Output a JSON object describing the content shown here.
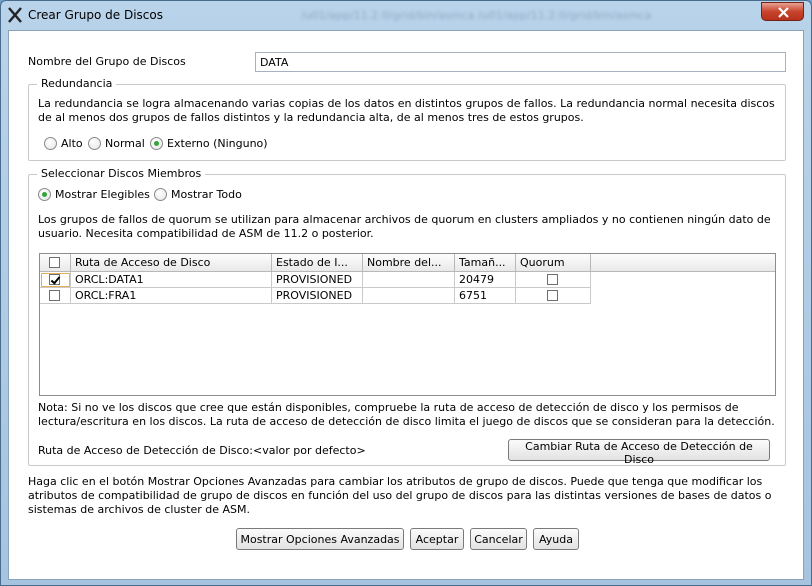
{
  "window": {
    "title": "Crear Grupo de Discos",
    "title_path": "/u01/app/11.2.0/grid/bin/asmca /u01/app/11.2.0/grid/bin/asmca"
  },
  "diskgroup": {
    "name_label": "Nombre del Grupo de Discos",
    "name_value": "DATA"
  },
  "redundancy": {
    "legend": "Redundancia",
    "description": "La redundancia se logra almacenando varias copias de los datos en distintos grupos de fallos. La redundancia normal necesita discos de al menos dos grupos de fallos distintos y la redundancia alta, de al menos tres de estos grupos.",
    "options": [
      "Alto",
      "Normal",
      "Externo (Ninguno)"
    ],
    "selected": "Externo (Ninguno)"
  },
  "members": {
    "legend": "Seleccionar Discos Miembros",
    "show_options": [
      "Mostrar Elegibles",
      "Mostrar Todo"
    ],
    "selected": "Mostrar Elegibles",
    "quorum_note": "Los grupos de fallos de quorum se utilizan para almacenar archivos de quorum en clusters ampliados y no contienen ningún dato de usuario. Necesita compatibilidad de ASM de 11.2 o posterior.",
    "table": {
      "columns": [
        "",
        "Ruta de Acceso de Disco",
        "Estado de I...",
        "Nombre del...",
        "Tamañ...",
        "Quorum"
      ],
      "rows": [
        {
          "selected": true,
          "path": "ORCL:DATA1",
          "status": "PROVISIONED",
          "name": "",
          "size": "20479",
          "quorum": false
        },
        {
          "selected": false,
          "path": "ORCL:FRA1",
          "status": "PROVISIONED",
          "name": "",
          "size": "6751",
          "quorum": false
        }
      ]
    },
    "note": "Nota: Si no ve los discos que cree que están disponibles, compruebe la ruta de acceso de detección de disco y los permisos de lectura/escritura en los discos. La ruta de acceso de detección de disco limita el juego de discos que se consideran para la detección.",
    "discovery_label": "Ruta de Acceso de Detección de Disco:<valor por defecto>",
    "change_discovery_button": "Cambiar Ruta de Acceso de Detección de Disco"
  },
  "advanced_note": "Haga clic en el botón Mostrar Opciones Avanzadas para cambiar los atributos de grupo de discos. Puede que tenga que modificar los atributos de compatibilidad de grupo de discos en función del uso del grupo de discos para las distintas versiones de bases de datos o sistemas de archivos de cluster de ASM.",
  "buttons": {
    "advanced": "Mostrar Opciones Avanzadas",
    "accept": "Aceptar",
    "cancel": "Cancelar",
    "help": "Ayuda"
  },
  "colors": {
    "title_gradient_top": "#b9d3ea",
    "radio_selected": "#34a33a",
    "close_button": "#c8442d"
  }
}
